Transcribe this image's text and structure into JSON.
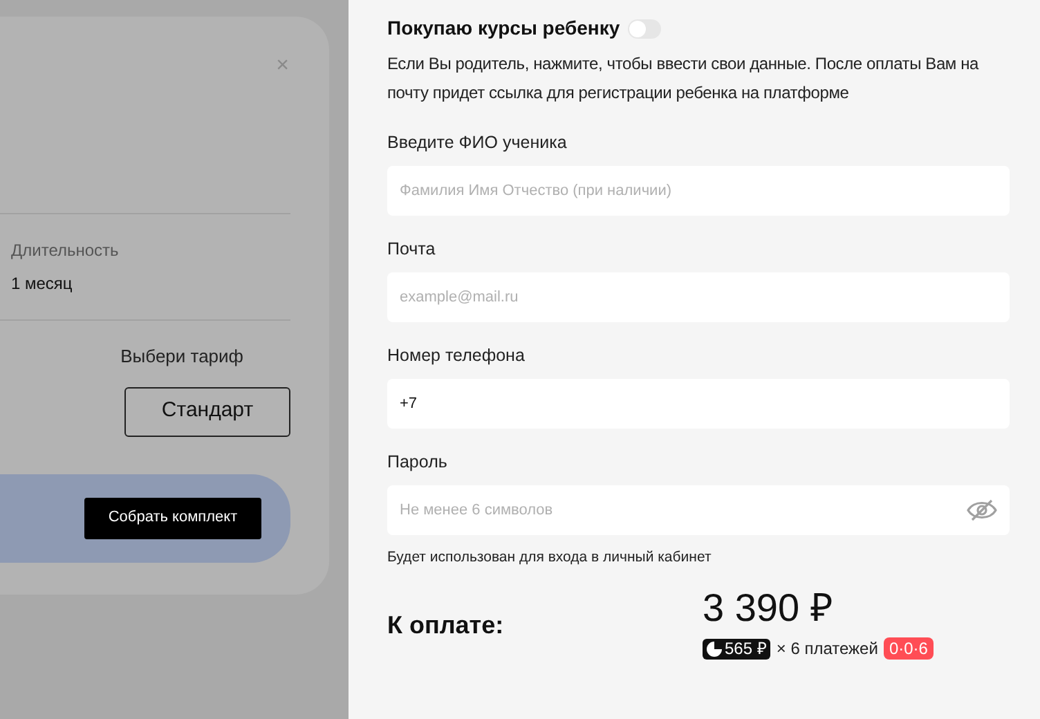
{
  "background_modal": {
    "close": "×",
    "duration_label": "Длительность",
    "duration_value": "1 месяц",
    "tariff_label": "Выбери тариф",
    "tariff_button": "Стандарт",
    "assemble_button": "Собрать комплект"
  },
  "form": {
    "child_toggle": {
      "label": "Покупаю курсы ребенку",
      "on": false
    },
    "description": "Если Вы родитель, нажмите, чтобы ввести свои данные. После оплаты Вам на почту придет ссылка для регистрации ребенка на платформе",
    "fields": [
      {
        "kind": "text",
        "label": "Введите ФИО ученика",
        "placeholder": "Фамилия Имя Отчество (при наличии)"
      },
      {
        "kind": "text",
        "label": "Почта",
        "placeholder": "example@mail.ru"
      },
      {
        "kind": "text",
        "label": "Номер телефона",
        "value": "+7"
      },
      {
        "kind": "password",
        "label": "Пароль",
        "placeholder": "Не менее 6 символов",
        "hint": "Будет использован для входа в личный кабинет"
      }
    ]
  },
  "payment": {
    "label": "К оплате:",
    "total": "3 390 ₽",
    "installment": "565 ₽",
    "times": "× 6 платежей",
    "promo": "0·0·6"
  }
}
